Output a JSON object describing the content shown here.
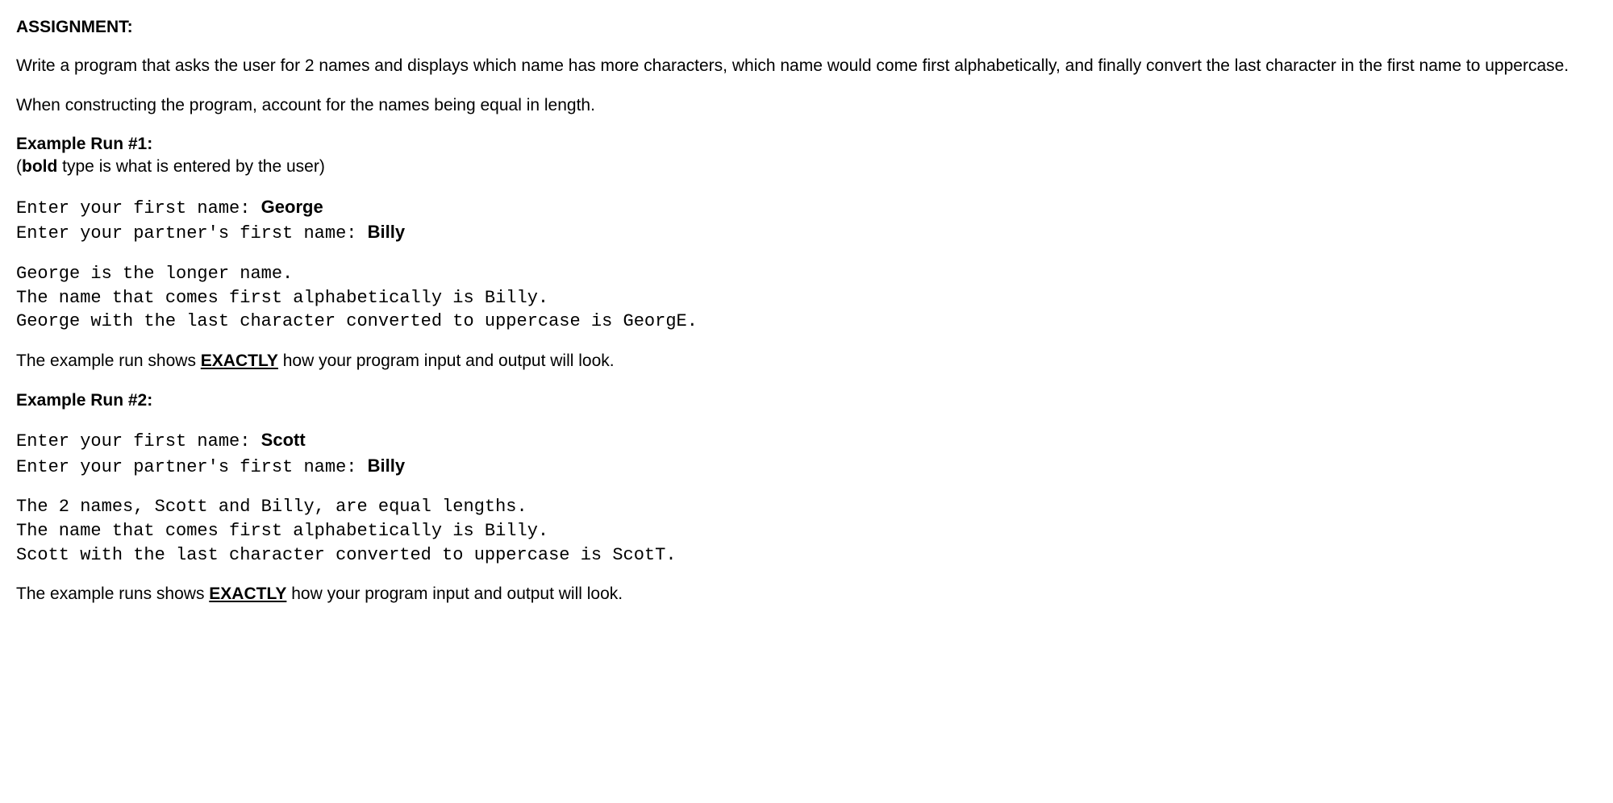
{
  "heading": "ASSIGNMENT:",
  "intro1": "Write a program that asks the user for 2 names and displays which name has more characters, which name would come first alphabetically, and finally convert the last character in the first name to uppercase.",
  "intro2": "When constructing the program, account for the names being equal in length.",
  "ex1_label": "Example Run #1:",
  "ex1_note_open": "(",
  "ex1_note_bold": "bold",
  "ex1_note_rest": " type is what is entered by the user)",
  "ex1_prompt1": "Enter your first name: ",
  "ex1_input1": "George",
  "ex1_prompt2": "Enter your partner's first name: ",
  "ex1_input2": "Billy",
  "ex1_out1": "George is the longer name.",
  "ex1_out2": "The name that comes first alphabetically is Billy.",
  "ex1_out3": "George with the last character converted to uppercase is GeorgE.",
  "ex1_footer_a": "The example run shows ",
  "ex1_footer_b": "EXACTLY",
  "ex1_footer_c": " how your program input and output will look.",
  "ex2_label": "Example Run #2:",
  "ex2_prompt1": "Enter your first name: ",
  "ex2_input1": "Scott",
  "ex2_prompt2": "Enter your partner's first name: ",
  "ex2_input2": "Billy",
  "ex2_out1": "The 2 names, Scott and Billy, are equal lengths.",
  "ex2_out2": "The name that comes first alphabetically is Billy.",
  "ex2_out3": "Scott with the last character converted to uppercase is ScotT.",
  "ex2_footer_a": "The example runs shows ",
  "ex2_footer_b": "EXACTLY",
  "ex2_footer_c": " how your program input and output will look."
}
